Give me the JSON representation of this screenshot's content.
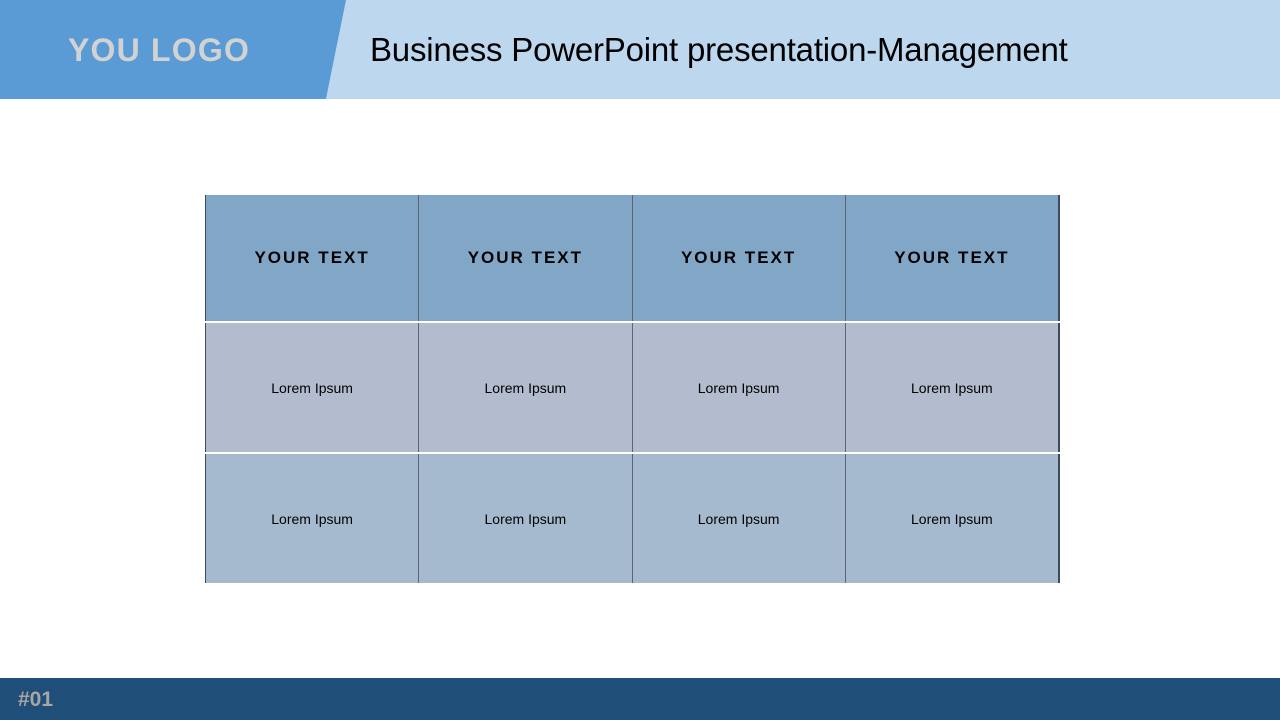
{
  "header": {
    "logo_text": "YOU LOGO",
    "title": "Business PowerPoint presentation-Management",
    "logo_panel_color": "#5b9bd5",
    "band_color": "#bdd7ee",
    "logo_text_color": "#d2d2d2"
  },
  "table": {
    "columns": 4,
    "rows": 3,
    "header_row": {
      "background": "#82a6c6",
      "cells": [
        {
          "label": "YOUR TEXT"
        },
        {
          "label": "YOUR TEXT"
        },
        {
          "label": "YOUR TEXT"
        },
        {
          "label": "YOUR TEXT"
        }
      ]
    },
    "body_rows": [
      {
        "background": "#b3bccf",
        "cells": [
          {
            "label": "Lorem Ipsum"
          },
          {
            "label": "Lorem Ipsum"
          },
          {
            "label": "Lorem Ipsum"
          },
          {
            "label": "Lorem Ipsum"
          }
        ]
      },
      {
        "background": "#a5bacf",
        "cells": [
          {
            "label": "Lorem Ipsum"
          },
          {
            "label": "Lorem Ipsum"
          },
          {
            "label": "Lorem Ipsum"
          },
          {
            "label": "Lorem Ipsum"
          }
        ]
      }
    ]
  },
  "footer": {
    "slide_number": "#01",
    "background": "#1f4e79",
    "text_color": "#a6a6a6"
  }
}
